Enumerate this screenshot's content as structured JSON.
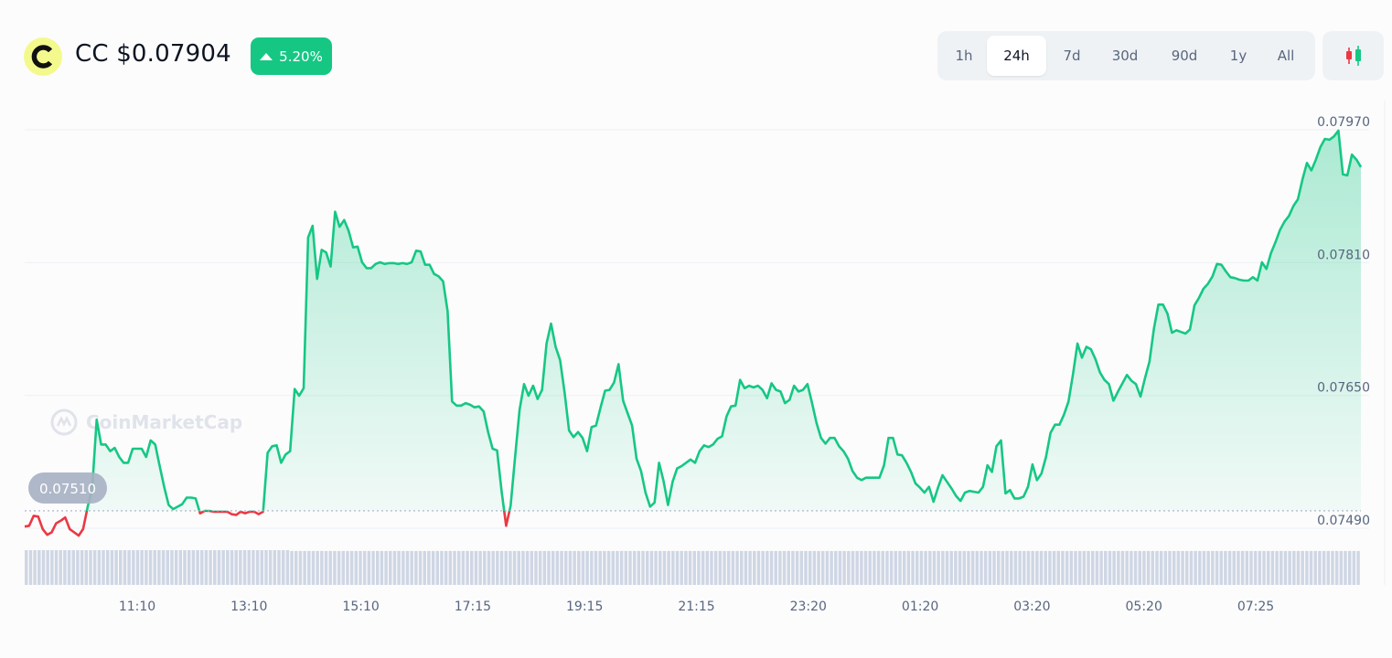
{
  "header": {
    "symbol": "CC",
    "price": "$0.07904",
    "change": "5.20%",
    "change_direction": "up",
    "icons": {
      "logo": "coin-logo-icon",
      "change": "caret-up-icon",
      "candles": "candlestick-icon"
    }
  },
  "range_selector": {
    "options": [
      "1h",
      "24h",
      "7d",
      "30d",
      "90d",
      "1y",
      "All"
    ],
    "selected": "24h"
  },
  "watermark": "CoinMarketCap",
  "colors": {
    "up": "#16c784",
    "down": "#ea3943",
    "grid": "#eff2f5",
    "text_muted": "#58667e",
    "volume": "#cfd6e4",
    "logo_bg": "#f4f98d"
  },
  "chart_data": {
    "type": "area",
    "x_tick_labels": [
      "11:10",
      "13:10",
      "15:10",
      "17:15",
      "19:15",
      "21:15",
      "23:20",
      "01:20",
      "03:20",
      "05:20",
      "07:25"
    ],
    "y_tick_labels": [
      "0.07970",
      "0.07810",
      "0.07650",
      "0.07490"
    ],
    "ylim": [
      0.0749,
      0.0797
    ],
    "open_price": 0.0751,
    "open_price_label": "0.07510",
    "legend": "none",
    "grid": "horizontal",
    "series": [
      {
        "values": [
          0.07491,
          0.07492,
          0.07504,
          0.07503,
          0.07488,
          0.07481,
          0.07484,
          0.07495,
          0.07498,
          0.07502,
          0.07488,
          0.07484,
          0.0748,
          0.07488,
          0.07515,
          0.07537,
          0.0762,
          0.0759,
          0.0759,
          0.07582,
          0.07586,
          0.07575,
          0.07568,
          0.07568,
          0.07585,
          0.07585,
          0.07585,
          0.07575,
          0.07595,
          0.0759,
          0.07564,
          0.07539,
          0.07517,
          0.07512,
          0.07515,
          0.07518,
          0.07526,
          0.07526,
          0.07525,
          0.07507,
          0.0751,
          0.0751,
          0.07509,
          0.07509,
          0.07509,
          0.07509,
          0.07506,
          0.07505,
          0.07509,
          0.07507,
          0.07509,
          0.07509,
          0.07506,
          0.07509,
          0.0758,
          0.07588,
          0.07589,
          0.07568,
          0.07578,
          0.07582,
          0.07657,
          0.07649,
          0.07658,
          0.0784,
          0.07854,
          0.0779,
          0.07825,
          0.07822,
          0.07805,
          0.07871,
          0.07853,
          0.07861,
          0.07848,
          0.07828,
          0.07829,
          0.0781,
          0.07803,
          0.07803,
          0.07808,
          0.0781,
          0.07808,
          0.07809,
          0.07809,
          0.07808,
          0.07809,
          0.07808,
          0.0781,
          0.07824,
          0.07823,
          0.07807,
          0.07807,
          0.07796,
          0.07793,
          0.07787,
          0.07751,
          0.07642,
          0.07637,
          0.07637,
          0.0764,
          0.07638,
          0.07635,
          0.07636,
          0.0763,
          0.07605,
          0.07585,
          0.07583,
          0.07534,
          0.07492,
          0.07516,
          0.07575,
          0.07632,
          0.07663,
          0.07649,
          0.07661,
          0.07645,
          0.07656,
          0.07712,
          0.07736,
          0.07708,
          0.07692,
          0.07653,
          0.07607,
          0.07599,
          0.07605,
          0.07598,
          0.07582,
          0.07611,
          0.07613,
          0.07635,
          0.07655,
          0.07656,
          0.07665,
          0.07687,
          0.07643,
          0.07628,
          0.07613,
          0.07573,
          0.07558,
          0.07532,
          0.07515,
          0.0752,
          0.07568,
          0.07546,
          0.07517,
          0.07545,
          0.07561,
          0.07564,
          0.07568,
          0.07572,
          0.07568,
          0.07582,
          0.07589,
          0.07587,
          0.0759,
          0.07597,
          0.076,
          0.07624,
          0.07636,
          0.07637,
          0.07668,
          0.07658,
          0.07661,
          0.07659,
          0.07661,
          0.07656,
          0.07646,
          0.07664,
          0.07656,
          0.07654,
          0.0764,
          0.07644,
          0.07661,
          0.07654,
          0.07656,
          0.07663,
          0.0764,
          0.07616,
          0.07598,
          0.07591,
          0.07598,
          0.07598,
          0.07588,
          0.07582,
          0.07573,
          0.07558,
          0.0755,
          0.07547,
          0.0755,
          0.0755,
          0.0755,
          0.0755,
          0.07565,
          0.07598,
          0.07598,
          0.07578,
          0.07577,
          0.07568,
          0.07557,
          0.07543,
          0.07538,
          0.07532,
          0.07539,
          0.07521,
          0.07538,
          0.07553,
          0.07545,
          0.07537,
          0.07528,
          0.07522,
          0.07532,
          0.07534,
          0.07533,
          0.07532,
          0.07539,
          0.07565,
          0.07557,
          0.07588,
          0.07595,
          0.07531,
          0.07535,
          0.07525,
          0.07525,
          0.07527,
          0.07539,
          0.07566,
          0.07547,
          0.07555,
          0.07575,
          0.07604,
          0.07614,
          0.07614,
          0.07626,
          0.07642,
          0.07675,
          0.07712,
          0.07695,
          0.07708,
          0.07705,
          0.07693,
          0.07677,
          0.07668,
          0.07663,
          0.07643,
          0.07654,
          0.07664,
          0.07674,
          0.07667,
          0.07663,
          0.07648,
          0.0767,
          0.0769,
          0.0773,
          0.07759,
          0.07759,
          0.07748,
          0.07725,
          0.07728,
          0.07726,
          0.07724,
          0.07729,
          0.07758,
          0.07767,
          0.07778,
          0.07784,
          0.07793,
          0.07808,
          0.07807,
          0.07799,
          0.07792,
          0.07791,
          0.07789,
          0.07788,
          0.07788,
          0.07792,
          0.07788,
          0.0781,
          0.07802,
          0.07821,
          0.07834,
          0.07849,
          0.07859,
          0.07866,
          0.07878,
          0.07886,
          0.0791,
          0.0793,
          0.07921,
          0.07934,
          0.07949,
          0.07959,
          0.07958,
          0.07962,
          0.07969,
          0.07916,
          0.07915,
          0.0794,
          0.07934,
          0.07925
        ]
      }
    ],
    "volume": [
      42,
      42,
      42,
      42,
      42,
      42,
      42,
      42,
      42,
      42,
      42,
      42,
      42,
      42,
      42,
      42,
      42,
      42,
      42,
      42,
      42,
      42,
      42,
      42,
      42,
      42,
      42,
      42,
      42,
      42,
      42,
      42,
      42,
      42,
      42,
      42,
      42,
      42,
      42,
      42,
      42,
      42,
      42,
      42,
      42,
      42,
      42,
      42,
      42,
      42,
      42,
      42,
      42,
      42,
      42,
      42,
      42,
      42,
      42,
      42,
      42,
      42,
      41,
      41,
      41,
      41,
      41,
      41,
      41,
      41,
      41,
      41,
      41,
      41,
      41,
      41,
      41,
      41,
      41,
      41,
      41,
      41,
      41,
      41,
      41,
      41,
      41,
      41,
      41,
      41,
      41,
      41,
      41,
      41,
      41,
      41,
      41,
      41,
      41,
      41,
      41,
      41,
      41,
      41,
      41,
      41,
      41,
      41,
      41,
      41,
      41,
      41,
      41,
      41,
      41,
      41,
      41,
      41,
      41,
      41,
      41,
      41,
      41,
      41,
      41,
      41,
      41,
      41,
      41,
      41,
      41,
      41,
      41,
      41,
      41,
      41,
      41,
      41,
      41,
      41,
      41,
      41,
      41,
      41,
      41,
      41,
      41,
      41,
      41,
      41,
      41,
      41,
      41,
      41,
      41,
      41,
      41,
      41,
      41,
      41,
      41,
      41,
      41,
      41,
      41,
      41,
      41,
      41,
      41,
      41,
      41,
      41,
      41,
      41,
      41,
      41,
      41,
      41,
      41,
      41,
      41,
      41,
      41,
      41,
      41,
      41,
      41,
      41,
      41,
      41,
      41,
      41,
      41,
      41,
      41,
      41,
      41,
      41,
      41,
      41,
      41,
      41,
      41,
      41,
      41,
      41,
      41,
      41,
      41,
      41,
      41,
      41,
      41,
      41,
      41,
      41,
      41,
      41,
      41,
      41,
      41,
      41,
      41,
      41,
      41,
      41,
      41,
      41,
      41,
      41,
      41,
      41,
      41,
      41,
      41,
      41,
      41,
      41,
      41,
      41,
      41,
      41,
      41,
      41,
      41,
      41,
      41,
      41,
      41,
      41,
      41,
      41,
      41,
      41,
      41,
      41,
      41,
      41,
      41,
      41,
      41,
      41,
      41,
      41,
      41,
      41,
      41,
      41,
      41,
      41,
      41,
      41,
      41,
      41,
      41,
      41,
      41,
      41,
      41,
      41,
      41,
      41,
      41,
      41,
      41,
      41,
      41,
      41,
      41,
      41,
      41,
      41,
      41,
      41,
      41,
      41,
      41,
      41,
      41,
      41,
      41,
      41,
      41,
      41,
      41,
      41,
      41,
      41,
      41,
      41,
      41,
      41
    ]
  }
}
